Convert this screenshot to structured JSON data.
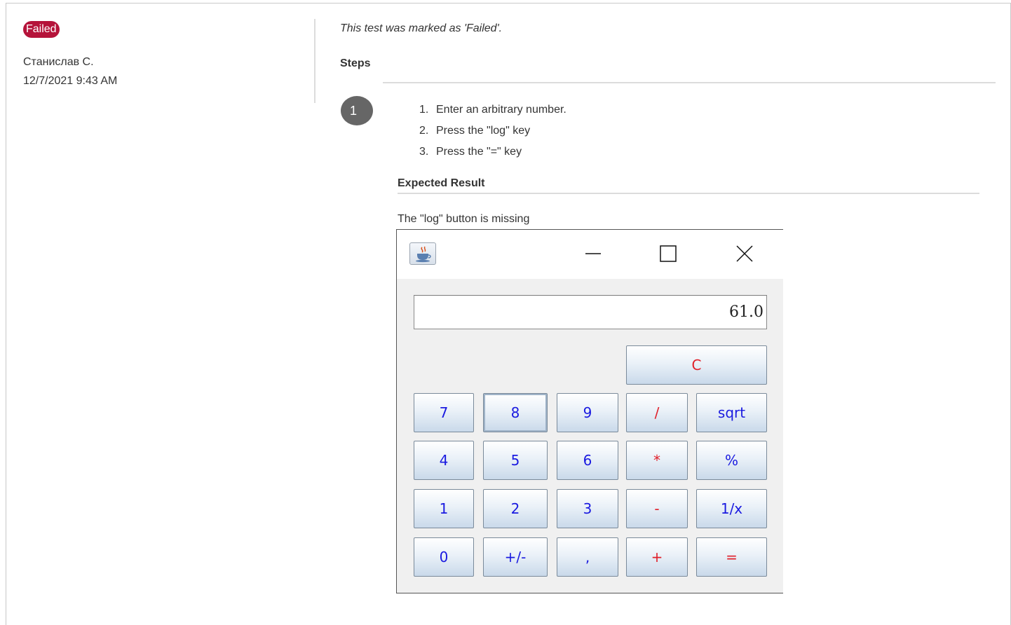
{
  "result": {
    "status": "Failed",
    "author": "Станислав С.",
    "timestamp": "12/7/2021 9:43 AM",
    "note": "This test was marked as 'Failed'."
  },
  "steps": {
    "title": "Steps",
    "items": [
      {
        "number": "1",
        "lines": [
          {
            "num": "1.",
            "text": "Enter an arbitrary number."
          },
          {
            "num": "2.",
            "text": "Press the \"log\" key"
          },
          {
            "num": "3.",
            "text": "Press the \"=\" key"
          }
        ],
        "expected_title": "Expected Result",
        "expected_text": "The \"log\" button is missing"
      }
    ]
  },
  "calculator": {
    "icons": {
      "app": "java-cup-icon",
      "minimize": "minimize-icon",
      "maximize": "maximize-icon",
      "close": "close-icon"
    },
    "display_value": "61.0",
    "clear_label": "C",
    "rows": [
      [
        "7",
        "8",
        "9",
        "/",
        "sqrt"
      ],
      [
        "4",
        "5",
        "6",
        "*",
        "%"
      ],
      [
        "1",
        "2",
        "3",
        "-",
        "1/x"
      ],
      [
        "0",
        "+/-",
        ",",
        "+",
        "="
      ]
    ],
    "colors": {
      "digit": "#1a1ae0",
      "operator": "#e0202a",
      "badge": "#b5133a"
    }
  }
}
